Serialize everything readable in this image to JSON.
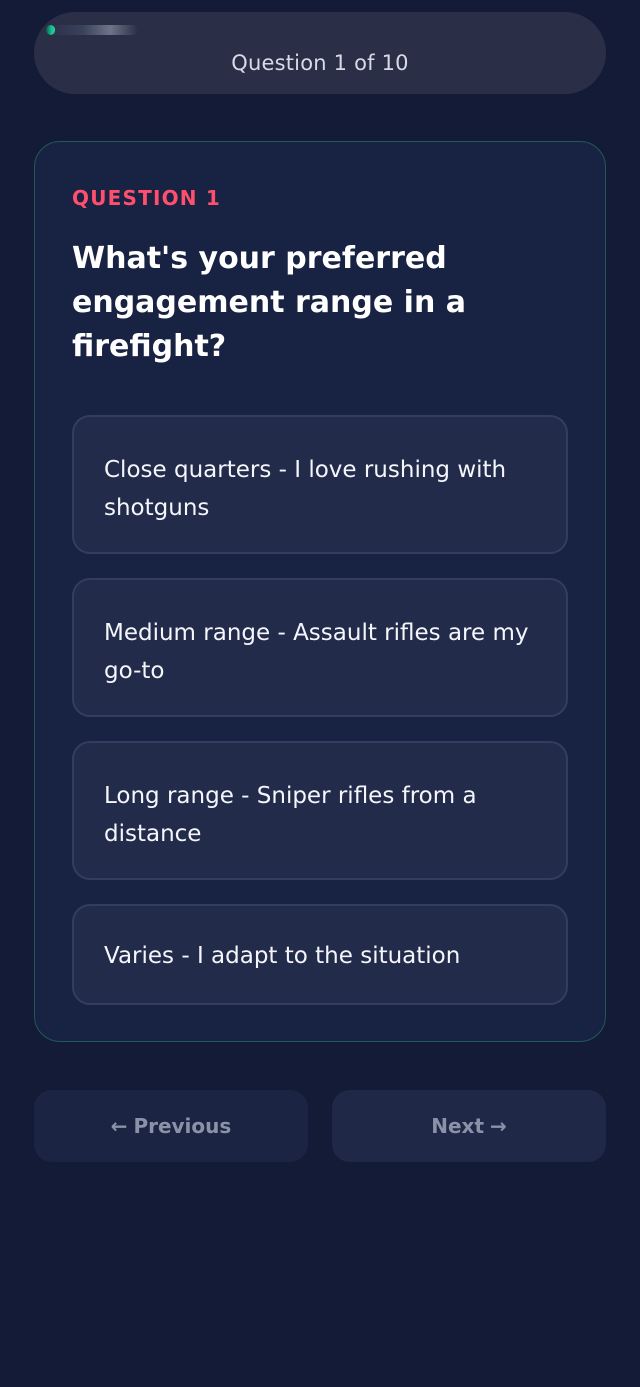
{
  "progress": {
    "text": "Question 1 of 10",
    "value": 0.1,
    "accent_color": "#16b98d"
  },
  "question": {
    "label": "QUESTION 1",
    "text": "What's your preferred engagement range in a firefight?",
    "options": [
      {
        "label": "Close quarters - I love rushing with shotguns"
      },
      {
        "label": "Medium range - Assault rifles are my go-to"
      },
      {
        "label": "Long range - Sniper rifles from a distance"
      },
      {
        "label": "Varies - I adapt to the situation"
      }
    ]
  },
  "navigation": {
    "previous_label": "Previous",
    "next_label": "Next",
    "previous_icon": "arrow-left-icon",
    "next_icon": "arrow-right-icon",
    "previous_arrow": "←",
    "next_arrow": "→"
  },
  "colors": {
    "background": "#141b36",
    "card_border": "#1f5a57",
    "accent_red": "#ff4f6d"
  }
}
